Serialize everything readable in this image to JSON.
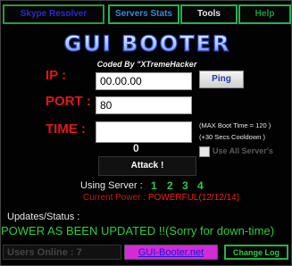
{
  "tabs": [
    {
      "label": "Skype Resolver"
    },
    {
      "label": "Servers Stats"
    },
    {
      "label": "Tools"
    },
    {
      "label": "Help"
    }
  ],
  "logo_text": "GUI BOOTER",
  "coded_by": "Coded By \"XTremeHacker",
  "form": {
    "ip_label": "IP :",
    "ip_value": "00.00.00",
    "port_label": "PORT :",
    "port_value": "80",
    "time_label": "TIME :",
    "time_value": "",
    "ping_label": "Ping",
    "max_boot_note": "(MAX Boot Time = 120 )",
    "cooldown_note": "(+30 Secs Cooldown )",
    "counter": "0",
    "use_all_servers_label": "Use All Server's",
    "attack_label": "Attack !"
  },
  "servers": {
    "label": "Using Server :",
    "numbers": [
      "1",
      "2",
      "3",
      "4"
    ]
  },
  "power": {
    "label": "Current Power :",
    "value": "POWERFUL(12/12/14)"
  },
  "updates": {
    "label": "Updates/Status :",
    "message": "POWER AS BEEN UPDATED !!(Sorry for down-time)"
  },
  "footer": {
    "users_online": "Users Online : 7",
    "site_link": "GUI-Booter.net",
    "changelog_label": "Change Log"
  },
  "colors": {
    "accent_green": "#2ecc40",
    "label_red": "#e01818",
    "link_magenta": "#d42ad8"
  }
}
